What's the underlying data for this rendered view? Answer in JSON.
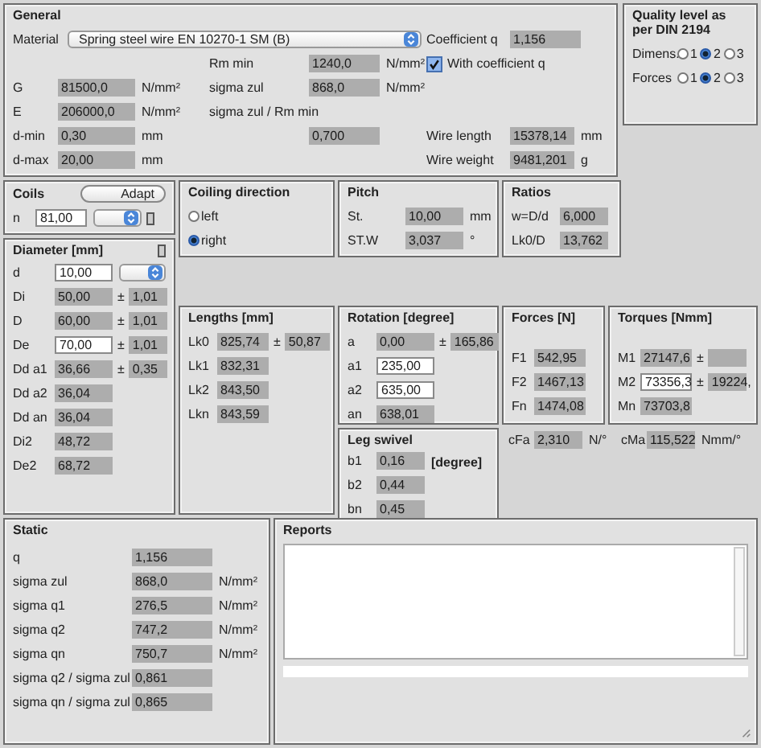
{
  "general": {
    "title": "General",
    "material": {
      "label": "Material",
      "value": "Spring steel wire EN 10270-1 SM (B)"
    },
    "coefficient": {
      "label": "Coefficient q",
      "value": "1,156",
      "editable": false
    },
    "with_coefficient": {
      "label": "With coefficient q",
      "checked": true
    },
    "left": [
      {
        "label": "G",
        "value": "81500,0",
        "unit": "N/mm²",
        "editable": false
      },
      {
        "label": "E",
        "value": "206000,0",
        "unit": "N/mm²",
        "editable": false
      },
      {
        "label": "d-min",
        "value": "0,30",
        "unit": "mm",
        "editable": false
      },
      {
        "label": "d-max",
        "value": "20,00",
        "unit": "mm",
        "editable": false
      }
    ],
    "middle": [
      {
        "kind": "field",
        "label": "Rm min",
        "value": "1240,0",
        "unit": "N/mm²",
        "editable": false
      },
      {
        "kind": "field",
        "label": "sigma zul",
        "value": "868,0",
        "unit": "N/mm²",
        "editable": false
      },
      {
        "kind": "caption",
        "label": "sigma zul / Rm min"
      },
      {
        "kind": "field",
        "value": "0,700",
        "editable": false
      }
    ],
    "right": [
      {
        "label": "Wire length",
        "value": "15378,14",
        "unit": "mm",
        "editable": false
      },
      {
        "label": "Wire weight",
        "value": "9481,201",
        "unit": "g",
        "editable": false
      }
    ]
  },
  "quality": {
    "title": "Quality level as per DIN 2194",
    "rows": [
      {
        "label": "Dimens.",
        "options": [
          {
            "label": "1",
            "selected": false
          },
          {
            "label": "2",
            "selected": true
          },
          {
            "label": "3",
            "selected": false
          }
        ]
      },
      {
        "label": "Forces",
        "options": [
          {
            "label": "1",
            "selected": false
          },
          {
            "label": "2",
            "selected": true
          },
          {
            "label": "3",
            "selected": false
          }
        ]
      }
    ]
  },
  "coils": {
    "title": "Coils",
    "button": "Adapt",
    "n": {
      "label": "n",
      "value": "81,00",
      "editable": true
    }
  },
  "diameter": {
    "title": "Diameter [mm]",
    "d": {
      "label": "d",
      "value": "10,00",
      "editable": true
    },
    "fields": [
      {
        "label": "Di",
        "value": "50,00",
        "pm": "±",
        "tolerance": "1,01",
        "editable": false
      },
      {
        "label": "D",
        "value": "60,00",
        "pm": "±",
        "tolerance": "1,01",
        "editable": false
      },
      {
        "label": "De",
        "value": "70,00",
        "pm": "±",
        "tolerance": "1,01",
        "editable": true
      },
      {
        "label": "Dd a1",
        "value": "36,66",
        "pm": "±",
        "tolerance": "0,35",
        "editable": false
      },
      {
        "label": "Dd a2",
        "value": "36,04",
        "editable": false
      },
      {
        "label": "Dd an",
        "value": "36,04",
        "editable": false
      },
      {
        "label": "Di2",
        "value": "48,72",
        "editable": false
      },
      {
        "label": "De2",
        "value": "68,72",
        "editable": false
      }
    ]
  },
  "coiling_direction": {
    "title": "Coiling direction",
    "options": [
      {
        "label": "left",
        "selected": false
      },
      {
        "label": "right",
        "selected": true
      }
    ]
  },
  "pitch": {
    "title": "Pitch",
    "fields": [
      {
        "label": "St.",
        "value": "10,00",
        "unit": "mm",
        "editable": false
      },
      {
        "label": "ST.W",
        "value": "3,037",
        "unit": "°",
        "editable": false
      }
    ]
  },
  "ratios": {
    "title": "Ratios",
    "fields": [
      {
        "label": "w=D/d",
        "value": "6,000",
        "editable": false
      },
      {
        "label": "Lk0/D",
        "value": "13,762",
        "editable": false
      }
    ]
  },
  "lengths": {
    "title": "Lengths [mm]",
    "fields": [
      {
        "label": "Lk0",
        "value": "825,74",
        "pm": "±",
        "tolerance": "50,87",
        "editable": false
      },
      {
        "label": "Lk1",
        "value": "832,31",
        "editable": false
      },
      {
        "label": "Lk2",
        "value": "843,50",
        "editable": false
      },
      {
        "label": "Lkn",
        "value": "843,59",
        "editable": false
      }
    ]
  },
  "rotation": {
    "title": "Rotation [degree]",
    "fields": [
      {
        "label": "a",
        "value": "0,00",
        "pm": "±",
        "tolerance": "165,86",
        "editable": false
      },
      {
        "label": "a1",
        "value": "235,00",
        "editable": true
      },
      {
        "label": "a2",
        "value": "635,00",
        "editable": true
      },
      {
        "label": "an",
        "value": "638,01",
        "editable": false
      }
    ]
  },
  "forces": {
    "title": "Forces [N]",
    "fields": [
      {
        "label": "F1",
        "value": "542,95",
        "editable": false
      },
      {
        "label": "F2",
        "value": "1467,13",
        "editable": false
      },
      {
        "label": "Fn",
        "value": "1474,08",
        "editable": false
      }
    ]
  },
  "torques": {
    "title": "Torques [Nmm]",
    "fields": [
      {
        "label": "M1",
        "value": "27147,6",
        "pm": "±",
        "editable": false
      },
      {
        "label": "M2",
        "value": "73356,3",
        "pm": "±",
        "tolerance": "19224,",
        "editable": true
      },
      {
        "label": "Mn",
        "value": "73703,8",
        "editable": false
      }
    ]
  },
  "stiffness": [
    {
      "label": "cFa",
      "value": "2,310",
      "unit": "N/°",
      "editable": false
    },
    {
      "label": "cMa",
      "value": "115,522",
      "unit": "Nmm/°",
      "editable": false
    }
  ],
  "leg_swivel": {
    "title": "Leg swivel",
    "caption": "[degree]",
    "fields": [
      {
        "label": "b1",
        "value": "0,16",
        "editable": false
      },
      {
        "label": "b2",
        "value": "0,44",
        "editable": false
      },
      {
        "label": "bn",
        "value": "0,45",
        "editable": false
      }
    ]
  },
  "static": {
    "title": "Static",
    "fields": [
      {
        "label": "q",
        "value": "1,156",
        "editable": false
      },
      {
        "label": "sigma zul",
        "value": "868,0",
        "unit": "N/mm²",
        "editable": false
      },
      {
        "label": "sigma q1",
        "value": "276,5",
        "unit": "N/mm²",
        "editable": false
      },
      {
        "label": "sigma q2",
        "value": "747,2",
        "unit": "N/mm²",
        "editable": false
      },
      {
        "label": "sigma qn",
        "value": "750,7",
        "unit": "N/mm²",
        "editable": false
      },
      {
        "label": "sigma q2 / sigma zul",
        "value": "0,861",
        "editable": false
      },
      {
        "label": "sigma qn / sigma zul",
        "value": "0,865",
        "editable": false
      }
    ]
  },
  "reports": {
    "title": "Reports"
  }
}
